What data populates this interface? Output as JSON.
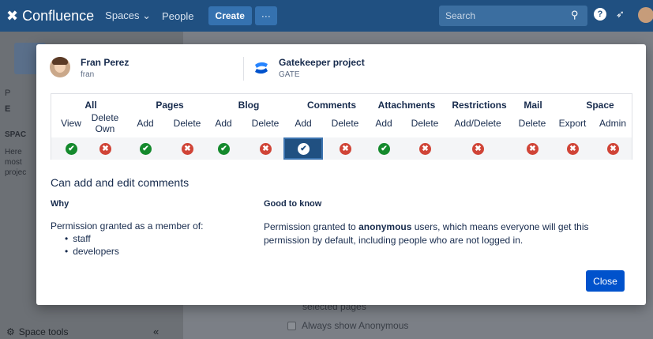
{
  "app": {
    "brand": "Confluence",
    "nav_spaces": "Spaces ⌄",
    "nav_people": "People",
    "create_label": "Create",
    "more_label": "···",
    "search_placeholder": "Search"
  },
  "sidebar": {
    "items": [
      "P",
      "E"
    ],
    "section_label": "SPAC",
    "desc_lines": [
      "Here",
      "most",
      "projec"
    ],
    "space_tools_label": "Space tools",
    "collapse_label": "«"
  },
  "background": {
    "selected_pages": "selected pages",
    "always_show_anonymous": "Always show Anonymous"
  },
  "dialog": {
    "user": {
      "name": "Fran Perez",
      "handle": "fran"
    },
    "space": {
      "name": "Gatekeeper project",
      "key": "GATE"
    },
    "groups": [
      "All",
      "Pages",
      "Blog",
      "Comments",
      "Attachments",
      "Restrictions",
      "Mail",
      "Space"
    ],
    "columns": [
      "View",
      "Delete Own",
      "Add",
      "Delete",
      "Add",
      "Delete",
      "Add",
      "Delete",
      "Add",
      "Delete",
      "Add/Delete",
      "Delete",
      "Export",
      "Admin"
    ],
    "permissions": [
      "granted",
      "denied",
      "granted",
      "denied",
      "granted",
      "denied",
      "granted",
      "denied",
      "granted",
      "denied",
      "denied",
      "denied",
      "denied",
      "denied"
    ],
    "selected_column": 6,
    "detail": {
      "title": "Can add and edit comments",
      "why_label": "Why",
      "why_text": "Permission granted as a member of:",
      "groups": [
        "staff",
        "developers"
      ],
      "good_to_know_label": "Good to know",
      "good_to_know_prefix": "Permission granted to ",
      "good_to_know_bold": "anonymous",
      "good_to_know_suffix": " users, which means everyone will get this permission by default, including people who are not logged in."
    },
    "close_label": "Close"
  },
  "colors": {
    "header": "#205081",
    "granted": "#14892c",
    "denied": "#d04437",
    "primary_button": "#0052cc"
  }
}
